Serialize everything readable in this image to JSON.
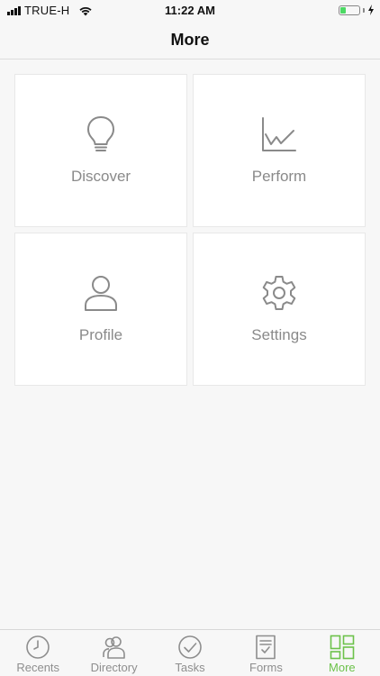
{
  "status_bar": {
    "carrier": "TRUE-H",
    "time": "11:22 AM",
    "battery_level": 0.25,
    "battery_color": "#4cd964"
  },
  "nav": {
    "title": "More"
  },
  "tiles": [
    {
      "label": "Discover",
      "icon": "lightbulb-icon"
    },
    {
      "label": "Perform",
      "icon": "line-chart-icon"
    },
    {
      "label": "Profile",
      "icon": "person-icon"
    },
    {
      "label": "Settings",
      "icon": "gear-icon"
    }
  ],
  "tabbar": {
    "active_color": "#6cc24a",
    "inactive_color": "#8e8e8e",
    "tabs": [
      {
        "label": "Recents",
        "icon": "clock-icon",
        "active": false
      },
      {
        "label": "Directory",
        "icon": "people-icon",
        "active": false
      },
      {
        "label": "Tasks",
        "icon": "checkmark-circle-icon",
        "active": false
      },
      {
        "label": "Forms",
        "icon": "form-document-icon",
        "active": false
      },
      {
        "label": "More",
        "icon": "grid-icon",
        "active": true
      }
    ]
  }
}
